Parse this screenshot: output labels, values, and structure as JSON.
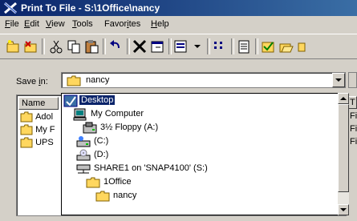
{
  "window": {
    "title": "Print To File - S:\\1Office\\nancy"
  },
  "menu": [
    {
      "label": "File",
      "u": "F",
      "rest": "ile"
    },
    {
      "label": "Edit",
      "u": "E",
      "rest": "dit"
    },
    {
      "label": "View",
      "u": "V",
      "rest": "iew"
    },
    {
      "label": "Tools",
      "u": "T",
      "rest": "ools"
    },
    {
      "label": "Favorites",
      "pre": "Favor",
      "u": "i",
      "rest": "tes"
    },
    {
      "label": "Help",
      "u": "H",
      "rest": "elp"
    }
  ],
  "save_in": {
    "label_pre": "Save ",
    "label_u": "i",
    "label_post": "n:",
    "value": "nancy"
  },
  "file_list": {
    "name_header": "Name",
    "type_header": "T",
    "rows": [
      {
        "name": "Adol",
        "type": "Fi"
      },
      {
        "name": "My F",
        "type": "Fi"
      },
      {
        "name": "UPS",
        "type": "Fi"
      }
    ]
  },
  "dropdown": {
    "items": [
      {
        "label": "Desktop",
        "icon": "desktop-icon",
        "selected": true
      },
      {
        "label": "My Computer",
        "icon": "computer-icon"
      },
      {
        "label": "3½ Floppy (A:)",
        "icon": "floppy-icon"
      },
      {
        "label": "(C:)",
        "icon": "drive-icon"
      },
      {
        "label": "(D:)",
        "icon": "cd-drive-icon"
      },
      {
        "label": "SHARE1 on 'SNAP4100' (S:)",
        "icon": "network-drive-icon"
      },
      {
        "label": "1Office",
        "icon": "folder-icon"
      },
      {
        "label": "nancy",
        "icon": "folder-icon"
      }
    ]
  },
  "colors": {
    "titlebar": "#0a246a",
    "selection": "#0a246a",
    "face": "#d4d0c8",
    "folder": "#ffd75e"
  }
}
